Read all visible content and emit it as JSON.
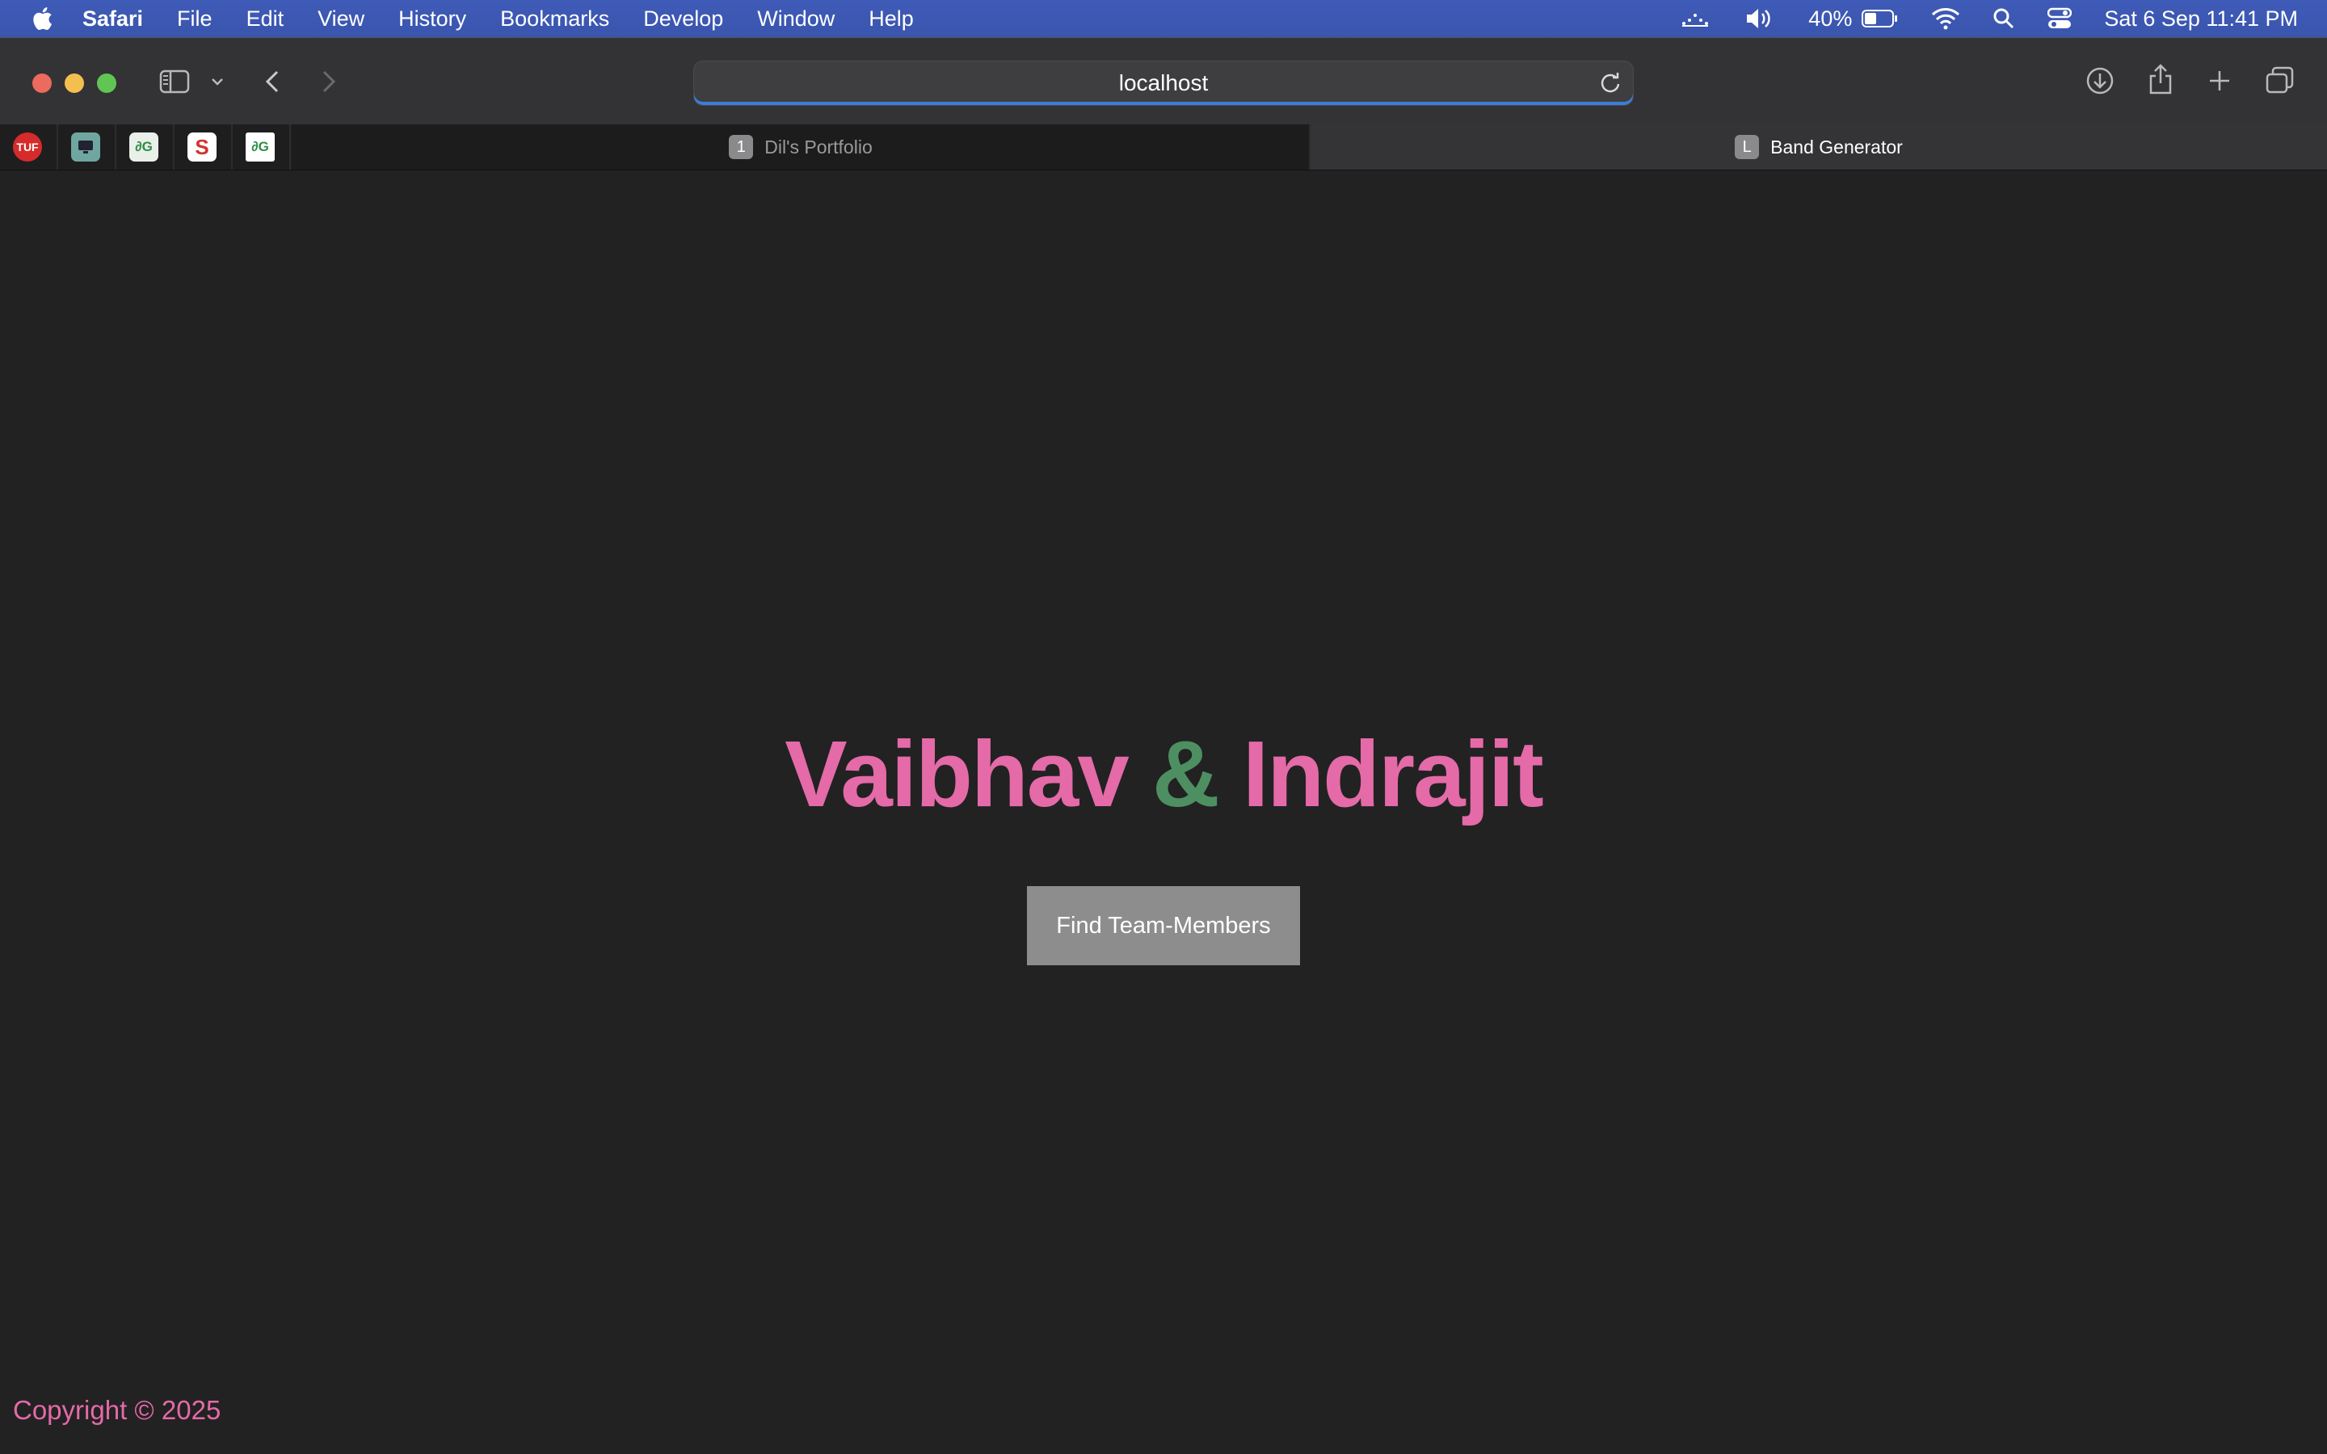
{
  "menubar": {
    "app_name": "Safari",
    "items": [
      "File",
      "Edit",
      "View",
      "History",
      "Bookmarks",
      "Develop",
      "Window",
      "Help"
    ],
    "battery_percent": "40%",
    "datetime": "Sat 6 Sep  11:41 PM"
  },
  "browser": {
    "url": "localhost",
    "pinned_tabs": [
      {
        "label": "TUF",
        "color": "#d62b2b"
      },
      {
        "label": "",
        "color": "#6fa6a0"
      },
      {
        "label": "∂G",
        "color": "#e9efe9"
      },
      {
        "label": "S",
        "color": "#d13333"
      },
      {
        "label": "∂G",
        "color": "#ffffff"
      }
    ],
    "tabs": [
      {
        "badge": "1",
        "title": "Dil's Portfolio",
        "active": false
      },
      {
        "badge": "L",
        "title": "Band Generator",
        "active": true
      }
    ]
  },
  "page": {
    "title_name1": "Vaibhav",
    "title_amp": "&",
    "title_name2": "Indrajit",
    "button_label": "Find Team-Members",
    "footer": "Copyright © 2025"
  },
  "colors": {
    "accent_pink": "#e46aa8",
    "accent_green": "#4e8f61",
    "button_bg": "#8d8d8d",
    "page_bg": "#222222"
  }
}
